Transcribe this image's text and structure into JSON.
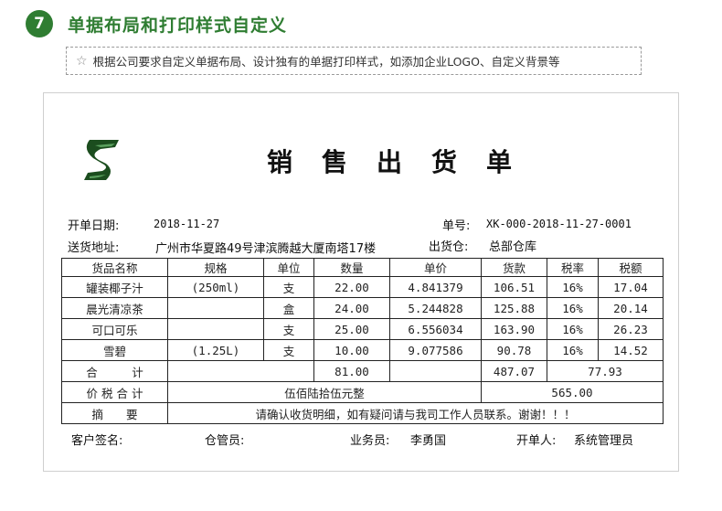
{
  "header": {
    "step_number": "7",
    "title": "单据布局和打印样式自定义",
    "tip": "根据公司要求自定义单据布局、设计独有的单据打印样式，如添加企业LOGO、自定义背景等"
  },
  "invoice": {
    "title": "销售出货单",
    "open_date_label": "开单日期:",
    "open_date": "2018-11-27",
    "number_label": "单号:",
    "number": "XK-000-2018-11-27-0001",
    "address_label": "送货地址:",
    "address": "广州市华夏路49号津滨腾越大厦南塔17楼",
    "warehouse_label": "出货仓:",
    "warehouse": "总部仓库",
    "columns": [
      "货品名称",
      "规格",
      "单位",
      "数量",
      "单价",
      "货款",
      "税率",
      "税额"
    ],
    "rows": [
      [
        "罐装椰子汁",
        "(250ml)",
        "支",
        "22.00",
        "4.841379",
        "106.51",
        "16%",
        "17.04"
      ],
      [
        "晨光清凉茶",
        "",
        "盒",
        "24.00",
        "5.244828",
        "125.88",
        "16%",
        "20.14"
      ],
      [
        "可口可乐",
        "",
        "支",
        "25.00",
        "6.556034",
        "163.90",
        "16%",
        "26.23"
      ],
      [
        "雪碧",
        "(1.25L)",
        "支",
        "10.00",
        "9.077586",
        "90.78",
        "16%",
        "14.52"
      ]
    ],
    "total_label": "合　　　计",
    "total_qty": "81.00",
    "total_amount": "487.07",
    "total_tax": "77.93",
    "tax_total_label": "价 税 合 计",
    "tax_total_words": "伍佰陆拾伍元整",
    "tax_total_value": "565.00",
    "summary_label": "摘　　要",
    "summary": "请确认收货明细，如有疑问请与我司工作人员联系。谢谢！！！",
    "customer_sign_label": "客户签名:",
    "keeper_label": "仓管员:",
    "salesman_label": "业务员:",
    "salesman": "李勇国",
    "issuer_label": "开单人:",
    "issuer": "系统管理员"
  },
  "colors": {
    "brand": "#2f7d32",
    "logo_dark": "#1b4d1e"
  }
}
